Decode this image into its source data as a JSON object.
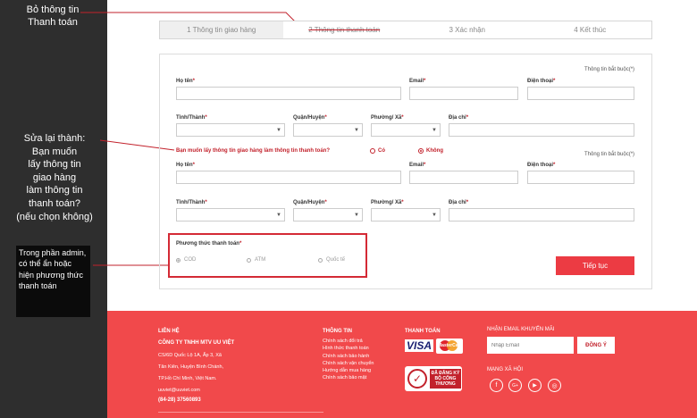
{
  "annotations": {
    "note1": "Bỏ thông tin\nThanh toán",
    "note2": "Sửa lại thành:\nBạn muốn\nlấy thông tin\ngiao hàng\nlàm thông tin\nthanh toán?\n(nếu chọn không)",
    "note3": "Trong phần admin, có thể ẩn hoặc hiện phương thức thanh toán"
  },
  "steps": [
    "1 Thông tin giao hàng",
    "2 Thông tin thanh toán",
    "3 Xác nhận",
    "4 Kết thúc"
  ],
  "form": {
    "required_note": "Thông tin bắt buộc(*)",
    "labels": {
      "name": "Họ tên",
      "email": "Email",
      "phone": "Điện thoại",
      "province": "Tỉnh/Thành",
      "district": "Quận/Huyện",
      "ward": "Phường/ Xã",
      "address": "Địa chỉ"
    },
    "star": "*",
    "question": "Bạn muốn lấy thông tin giao hàng làm thông tin thanh toán?",
    "option_yes": "Có",
    "option_no": "Không",
    "payment_title": "Phương thức thanh toán",
    "payment_options": [
      "COD",
      "ATM",
      "Quốc tế"
    ],
    "continue": "Tiếp tục"
  },
  "footer": {
    "contact_title": "LIÊN HỆ",
    "company": "CÔNG TY TNHH MTV UU VIỆT",
    "addr1": "CS/6D Quốc Lộ 1A, Ấp 3, Xã",
    "addr2": "Tân Kiên, Huyện Bình Chánh,",
    "addr3": "TP.Hồ Chí Minh, Việt Nam.",
    "email": "uuviet@uuviet.com",
    "phone": "(84-28) 37560893",
    "info_title": "THÔNG TIN",
    "info_links": [
      "Chính sách đổi trả",
      "Hình thức thanh toán",
      "Chính sách bảo hành",
      "Chính sách vận chuyển",
      "Hướng dẫn mua hàng",
      "Chính sách bảo mật"
    ],
    "payment_title": "THANH TOÁN",
    "visa": "VISA",
    "mastercard": "MasterCard",
    "badge": "ĐÃ ĐĂNG KÝ BỘ CÔNG THƯƠNG",
    "newsletter_title": "NHẬN EMAIL KHUYẾN MÃI",
    "newsletter_placeholder": "Nhập Email",
    "newsletter_button": "ĐỒNG Ý",
    "social_title": "MẠNG XÃ HỘI",
    "social_icons": [
      "f",
      "G+",
      "▶",
      "◎"
    ]
  }
}
